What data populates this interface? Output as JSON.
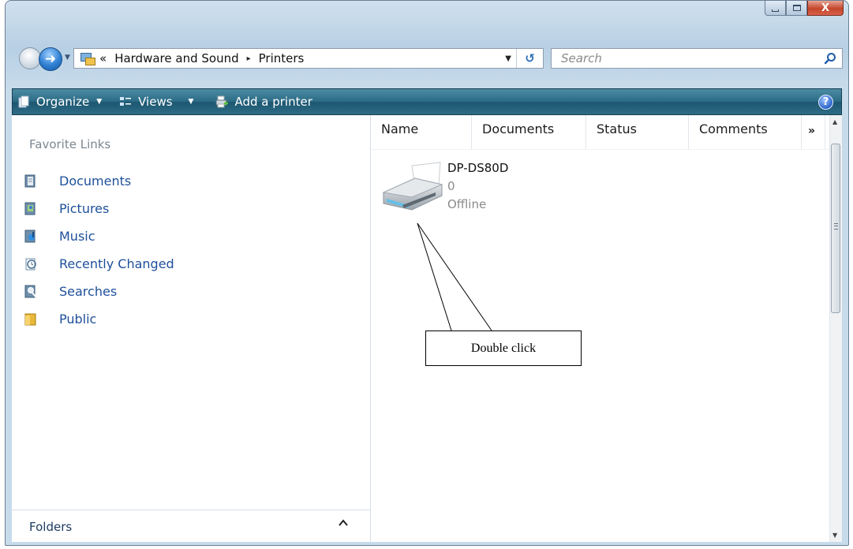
{
  "window": {
    "minimize_icon": "minimize-icon",
    "maximize_icon": "maximize-icon",
    "close_glyph": "X"
  },
  "nav": {
    "back_icon": "back-arrow-icon",
    "forward_icon": "forward-arrow-icon",
    "forward_glyph": "➜",
    "history_dropdown_glyph": "▼"
  },
  "address": {
    "overflow": "«",
    "segments": [
      "Hardware and Sound",
      "Printers"
    ],
    "separator": "▸",
    "dropdown_glyph": "▼",
    "refresh_glyph": "↺"
  },
  "search": {
    "placeholder": "Search"
  },
  "toolbar": {
    "organize": "Organize",
    "views": "Views",
    "add_printer": "Add a printer",
    "caret": "▼",
    "help": "?",
    "background_color": "#2b6a84"
  },
  "favorites": {
    "title": "Favorite Links",
    "items": [
      {
        "label": "Documents",
        "icon": "documents-icon"
      },
      {
        "label": "Pictures",
        "icon": "pictures-icon"
      },
      {
        "label": "Music",
        "icon": "music-icon"
      },
      {
        "label": "Recently Changed",
        "icon": "recently-changed-icon"
      },
      {
        "label": "Searches",
        "icon": "searches-icon"
      },
      {
        "label": "Public",
        "icon": "public-folder-icon"
      }
    ],
    "link_color": "#1e4f9a"
  },
  "folders": {
    "label": "Folders",
    "caret": "^"
  },
  "columns": {
    "headers": [
      "Name",
      "Documents",
      "Status",
      "Comments"
    ],
    "more": "»"
  },
  "printer": {
    "name": "DP-DS80D",
    "documents": "0",
    "status": "Offline",
    "icon": "printer-icon"
  },
  "callout": {
    "text": "Double click"
  }
}
